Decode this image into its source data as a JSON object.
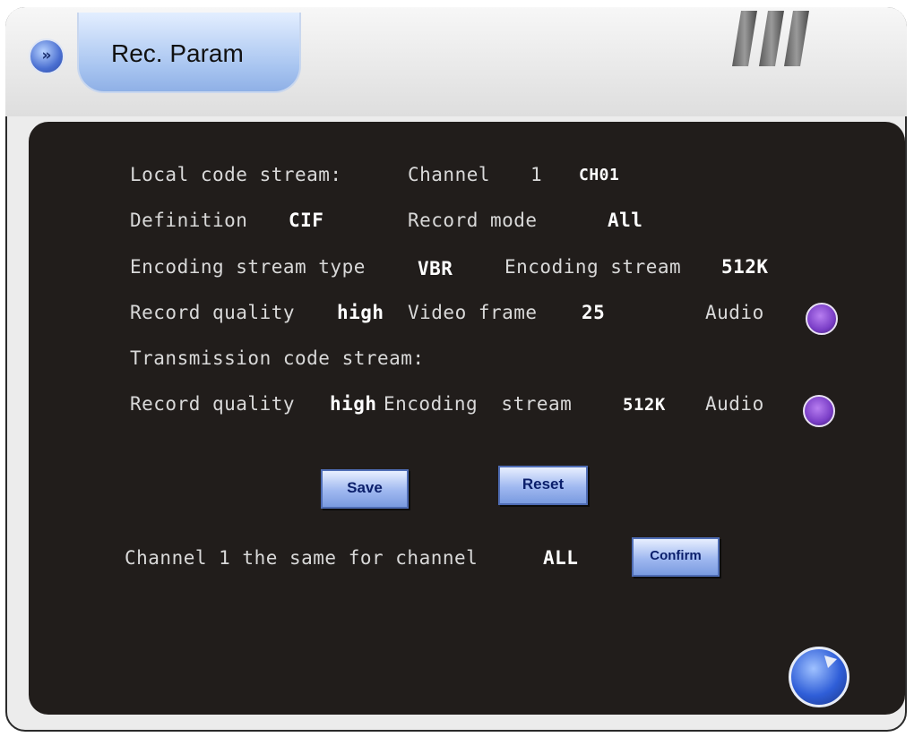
{
  "header": {
    "nav_icon": "double-chevron-right-icon",
    "nav_glyph": "»",
    "tab_label": "Rec. Param"
  },
  "local": {
    "section_label": "Local code stream:",
    "channel_label": "Channel",
    "channel_number": "1",
    "channel_name": "CH01",
    "definition_label": "Definition",
    "definition_value": "CIF",
    "record_mode_label": "Record mode",
    "record_mode_value": "All",
    "enc_type_label": "Encoding stream type",
    "enc_type_value": "VBR",
    "enc_stream_label": "Encoding stream",
    "enc_stream_value": "512K",
    "quality_label": "Record quality",
    "quality_value": "high",
    "frame_label": "Video frame",
    "frame_value": "25",
    "audio_label": "Audio"
  },
  "transmission": {
    "section_label": "Transmission code stream:",
    "quality_label": "Record quality",
    "quality_value": "high",
    "enc_stream_label": "Encoding  stream",
    "enc_stream_value": "512K",
    "audio_label": "Audio"
  },
  "buttons": {
    "save": "Save",
    "reset": "Reset",
    "confirm": "Confirm"
  },
  "copy": {
    "prefix": "Channel 1 the same for channel",
    "target": "ALL"
  },
  "colors": {
    "panel_bg": "#211d1b",
    "accent_blue": "#7a9be0",
    "radio_purple": "#7a3ec7"
  }
}
